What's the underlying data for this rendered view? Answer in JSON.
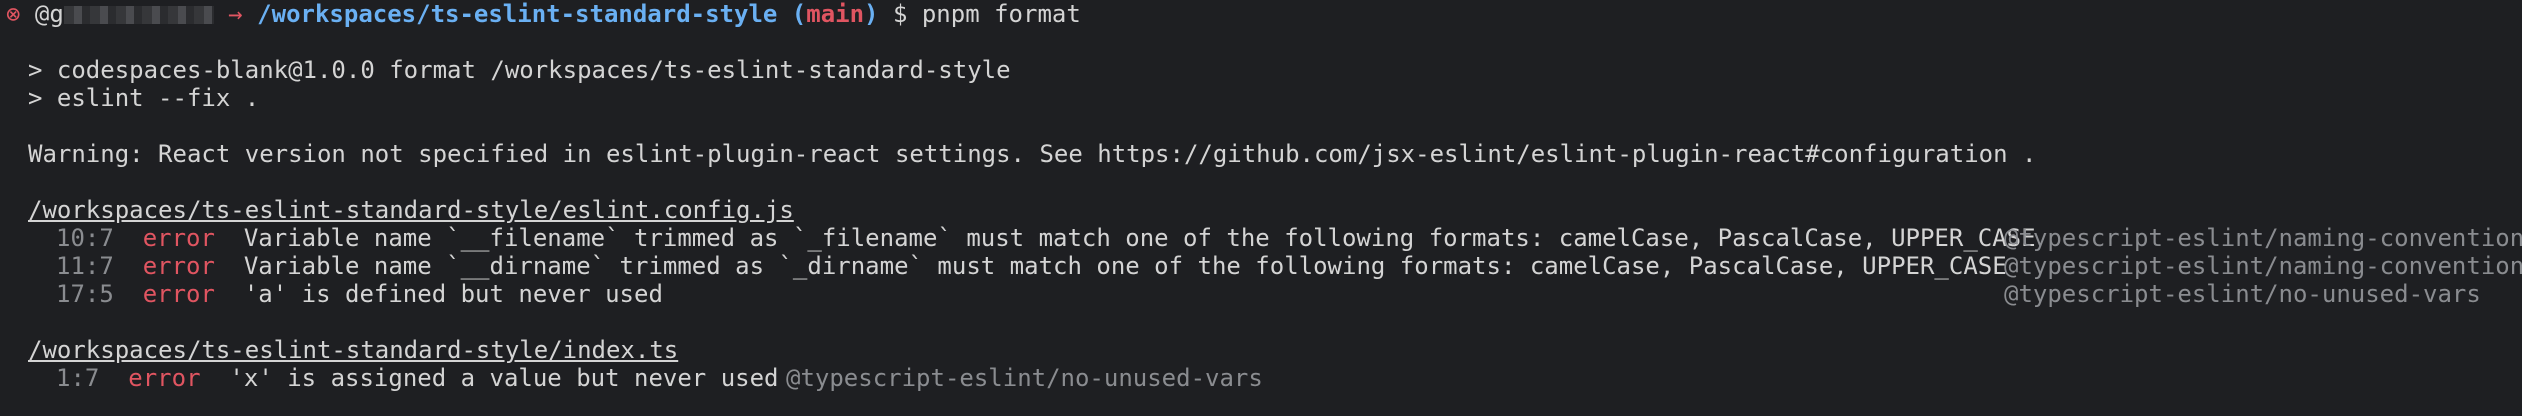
{
  "prompt": {
    "status_icon": "⊗",
    "user_prefix": "@g",
    "arrow": "→",
    "path": "/workspaces/ts-eslint-standard-style",
    "branch_open": "(",
    "branch": "main",
    "branch_close": ")",
    "dollar": "$",
    "command": "pnpm format"
  },
  "run": {
    "line1": "> codespaces-blank@1.0.0 format /workspaces/ts-eslint-standard-style",
    "line2": "> eslint --fix ."
  },
  "warning": "Warning: React version not specified in eslint-plugin-react settings. See https://github.com/jsx-eslint/eslint-plugin-react#configuration .",
  "files": [
    {
      "path": "/workspaces/ts-eslint-standard-style/eslint.config.js",
      "errors": [
        {
          "loc": "10:7",
          "level": "error",
          "message": "Variable name `__filename` trimmed as `_filename` must match one of the following formats: camelCase, PascalCase, UPPER_CASE",
          "rule": "@typescript-eslint/naming-convention"
        },
        {
          "loc": "11:7",
          "level": "error",
          "message": "Variable name `__dirname` trimmed as `_dirname` must match one of the following formats: camelCase, PascalCase, UPPER_CASE",
          "rule": "@typescript-eslint/naming-convention"
        },
        {
          "loc": "17:5",
          "level": "error",
          "message": "'a' is defined but never used",
          "rule": "@typescript-eslint/no-unused-vars"
        }
      ]
    },
    {
      "path": "/workspaces/ts-eslint-standard-style/index.ts",
      "errors": [
        {
          "loc": "1:7",
          "level": "error",
          "message": "'x' is assigned a value but never used",
          "rule": "@typescript-eslint/no-unused-vars"
        }
      ]
    }
  ],
  "colors": {
    "background": "#1e1f22",
    "path_blue": "#6ab0f3",
    "error_red": "#e05561",
    "dim_gray": "#8a8c90"
  }
}
